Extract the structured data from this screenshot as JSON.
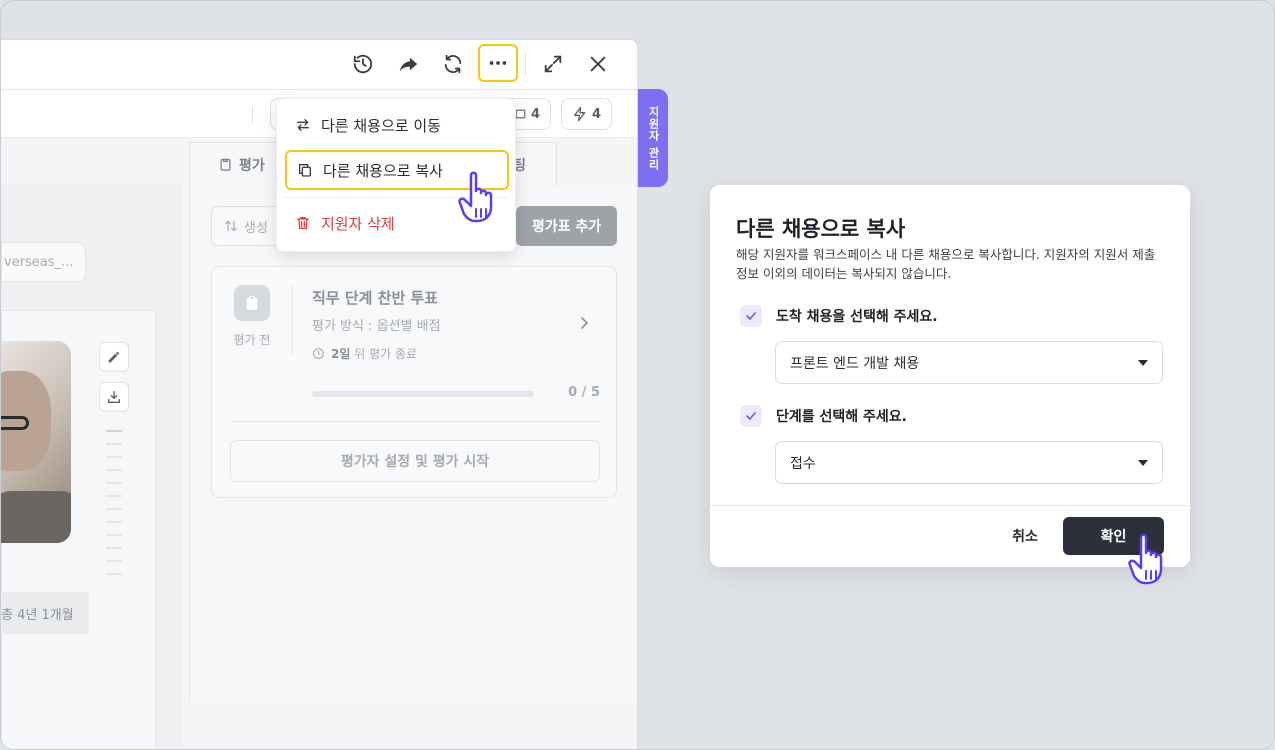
{
  "toolbar": {
    "history_icon": "history-icon",
    "share_icon": "share-icon",
    "refresh_icon": "refresh-icon",
    "more_icon": "more-icon",
    "expand_icon": "expand-icon",
    "close_icon": "close-icon"
  },
  "subbar": {
    "comment_count": "4",
    "flash_count": "4"
  },
  "left_panel": {
    "link_text": "verseas_...",
    "career_text": "총 4년 1개월"
  },
  "tabs": [
    {
      "label": "평가"
    },
    {
      "label": "팅"
    }
  ],
  "evaluation": {
    "sort_label": "생성",
    "add_button": "평가표 추가",
    "status": "평가 전",
    "title": "직무 단계 찬반 투표",
    "method": "평가 방식 : 옵션별 배점",
    "days_bold": "2일",
    "days_rest": "뒤 평가 종료",
    "progress_text": "0 / 5",
    "progress_fraction": 0,
    "start_button": "평가자 설정 및 평가 시작"
  },
  "menu": {
    "move": "다른 채용으로 이동",
    "copy": "다른 채용으로 복사",
    "delete": "지원자 삭제"
  },
  "side_tab": {
    "label": "지원자 관리"
  },
  "dialog": {
    "title": "다른 채용으로 복사",
    "description": "해당 지원자를 워크스페이스 내 다른 채용으로 복사합니다. 지원자의 지원서 제출 정보 이외의 데이터는 복사되지 않습니다.",
    "q1": "도착 채용을 선택해 주세요.",
    "q1_value": "프론트 엔드 개발 채용",
    "q2": "단계를 선택해 주세요.",
    "q2_value": "접수",
    "cancel": "취소",
    "confirm": "확인"
  },
  "colors": {
    "accent_purple": "#7e6ef1",
    "highlight_yellow": "#f5c518",
    "danger_red": "#e03a3a",
    "confirm_dark": "#2c3038"
  }
}
